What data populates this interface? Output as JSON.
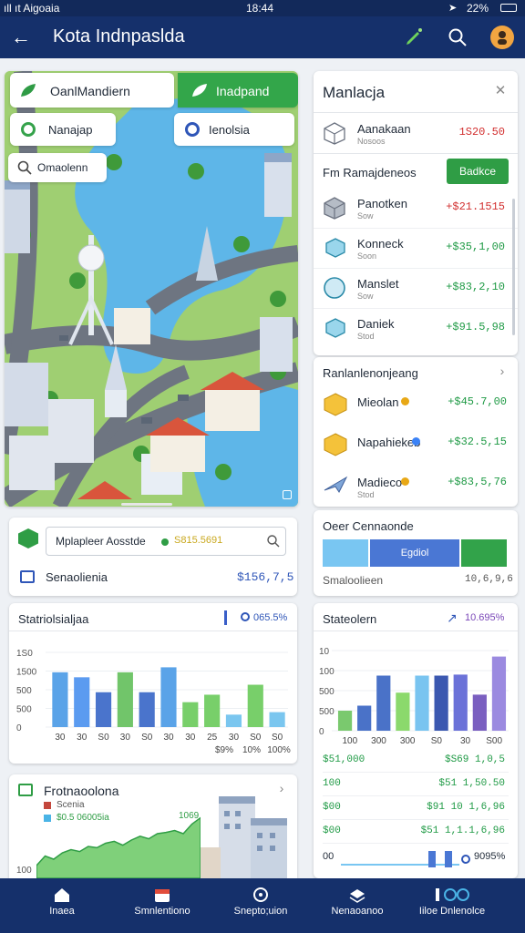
{
  "status": {
    "carrier": "ıll ıt Aigoaia",
    "time": "18:44",
    "battery": "22%"
  },
  "app": {
    "title": "Kota Indnpaslda"
  },
  "map": {
    "chips": {
      "chip_a": "OanlMandiern",
      "chip_b": "Inadpand",
      "chip_c": "Nanajap",
      "chip_d": "Ienolsia",
      "chip_e": "Omaolenn"
    }
  },
  "panel_market": {
    "title": "Manlacja",
    "items": [
      {
        "name": "Aanakaan",
        "sub": "Nosoos",
        "value": "1S20.50",
        "color": "#d22f2f",
        "icon": "cube-outline-icon"
      },
      {
        "name": "Panotken",
        "sub": "Sow",
        "value": "+$21.1515",
        "color": "#d22f2f",
        "icon": "cube-icon"
      },
      {
        "name": "Konneck",
        "sub": "Soon",
        "value": "+$35,1,00",
        "color": "#1f9a45",
        "icon": "box-teal-icon"
      },
      {
        "name": "Manslet",
        "sub": "Sow",
        "value": "+$83,2,10",
        "color": "#1f9a45",
        "icon": "circle-teal-icon"
      },
      {
        "name": "Daniek",
        "sub": "Stod",
        "value": "+$91.5,98",
        "color": "#1f9a45",
        "icon": "box-teal-icon"
      }
    ],
    "section": "Fm Ramajdeneos",
    "button": "Badkce"
  },
  "panel_assets": {
    "title": "Ranlanlenonjeang",
    "items": [
      {
        "name": "Mieolan",
        "sub": "",
        "value": "+$45.7,00",
        "color": "#1f9a45",
        "dot": "#e8a816"
      },
      {
        "name": "Napahiekeb",
        "sub": "",
        "value": "+$32.5,15",
        "color": "#1f9a45",
        "dot": "#3b82f6"
      },
      {
        "name": "Madieco",
        "sub": "Stod",
        "value": "+$83,5,76",
        "color": "#1f9a45",
        "dot": "#e8a816"
      }
    ]
  },
  "search_card": {
    "placeholder": "Mplapleer Aosstde",
    "hint": "S815.5691",
    "row_label": "Senaolienia",
    "row_value": "$156,7,5"
  },
  "controls": {
    "title": "Oeer Cennaonde",
    "button": "Egdiol",
    "label": "Smaloolieen",
    "value": "10,6,9,6"
  },
  "chart_left": {
    "title": "Statriolsialjaa",
    "stat": "065.5%"
  },
  "chart_right": {
    "title": "Stateolern",
    "stat": "10.695%"
  },
  "ledger": {
    "rows": [
      {
        "label": "$51,000",
        "value": "$S69 1,0,5"
      },
      {
        "label": "100",
        "value": "$51 1,50.50"
      },
      {
        "label": "$00",
        "value": "$91 10 1,6,96"
      },
      {
        "label": "$00",
        "value": "$51 1,1.1,6,96"
      }
    ],
    "stat_label": "00",
    "stat": "9095%"
  },
  "bottom_card": {
    "title": "Frotnaoolona",
    "legend_1": "Scenia",
    "legend_2": "$0.5 06005ia",
    "tag": "1069",
    "y_label": "100"
  },
  "nav": [
    {
      "label": "Inaea"
    },
    {
      "label": "Smnlentiono"
    },
    {
      "label": "Snepto;uion"
    },
    {
      "label": "Nenaoanoo"
    },
    {
      "label": "Iiloe Dnlenolce"
    }
  ],
  "chart_data": [
    {
      "type": "bar",
      "title": "Statriolsialjaa",
      "categories": [
        "30",
        "30",
        "S0",
        "30",
        "S0",
        "30",
        "30",
        "25",
        "30",
        "S0",
        "S0"
      ],
      "series": [
        {
          "values": [
            1100,
            1000,
            700,
            1100,
            700,
            1200,
            500,
            650,
            250,
            850,
            300
          ]
        }
      ],
      "colors": [
        "#5aa3e8",
        "#5b9bf0",
        "#4a74cc",
        "#71c56a",
        "#4a74cc",
        "#5aa3e8",
        "#78cf6a",
        "#78cf6a",
        "#7ac6ef",
        "#78cf6a",
        "#7ac6ef"
      ],
      "ylim": [
        0,
        1500
      ],
      "yticks": [
        "1S0",
        "1500",
        "500",
        "500",
        "0"
      ],
      "x_extra": [
        "$9%",
        "10%",
        "100%"
      ]
    },
    {
      "type": "bar",
      "title": "Stateolern",
      "categories": [
        "100",
        "300",
        "300",
        "S0",
        "30",
        "S00"
      ],
      "series": [
        {
          "values": [
            200,
            250,
            550,
            380,
            550,
            550,
            560,
            360,
            740
          ]
        }
      ],
      "colors": [
        "#7ac96e",
        "#4a72c8",
        "#4a72c8",
        "#8bd96c",
        "#79c4f0",
        "#3b58b0",
        "#6b72d8",
        "#7a5fc0",
        "#9b8ae0"
      ],
      "ylim": [
        0,
        800
      ],
      "yticks": [
        "10",
        "100",
        "500",
        "500",
        "0"
      ]
    },
    {
      "type": "area",
      "values": [
        20,
        35,
        30,
        40,
        45,
        42,
        50,
        48,
        55,
        58,
        52,
        60,
        66,
        62,
        70,
        72,
        75,
        70,
        85,
        95
      ]
    }
  ]
}
